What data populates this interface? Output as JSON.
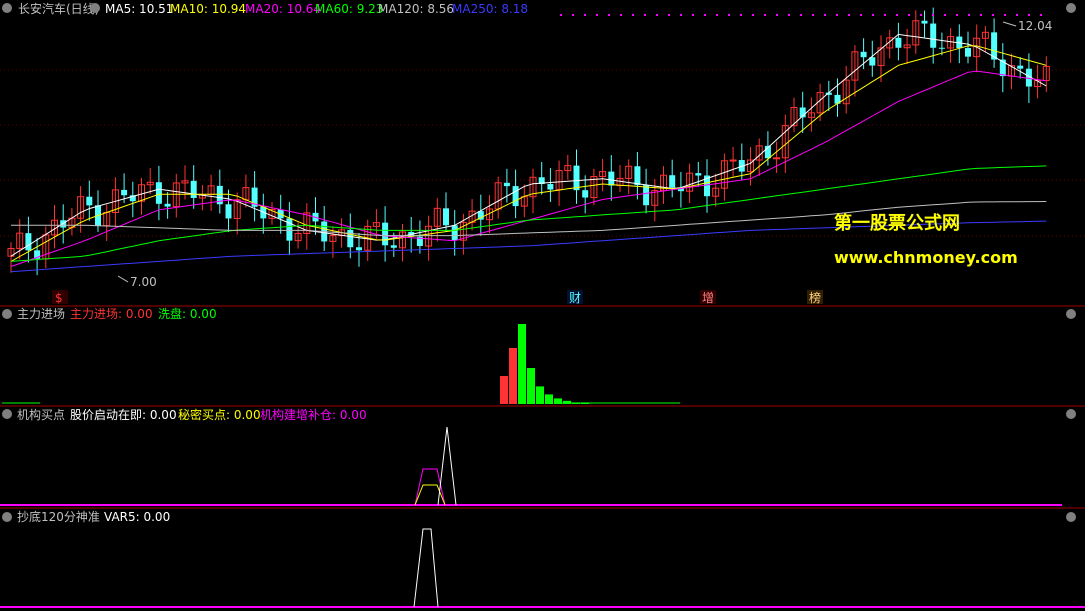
{
  "colors": {
    "bg": "#000000",
    "up": "#ff3333",
    "down": "#54ffff",
    "ma5": "#ffffff",
    "ma10": "#ffff00",
    "ma20": "#ff00ff",
    "ma60": "#00ff00",
    "ma120": "#c0c0c0",
    "ma250": "#3a3aff",
    "divider": "#a00000",
    "watermark": "#ffff00"
  },
  "main": {
    "stock_title": "长安汽车(日线)",
    "ma_items": [
      {
        "label": "MA5: 10.51",
        "color": "#ffffff"
      },
      {
        "label": "MA10: 10.94",
        "color": "#ffff00"
      },
      {
        "label": "MA20: 10.64",
        "color": "#ff00ff"
      },
      {
        "label": "MA60: 9.23",
        "color": "#00ff00"
      },
      {
        "label": "MA120: 8.56",
        "color": "#c0c0c0"
      },
      {
        "label": "MA250: 8.18",
        "color": "#3a3aff"
      }
    ],
    "high_label": "12.04",
    "low_label": "7.00",
    "markers": [
      "$",
      "财",
      "增",
      "榜"
    ],
    "watermark_title": "第一股票公式网",
    "watermark_url": "www.chnmoney.com"
  },
  "panel1": {
    "title": "主力进场",
    "items": [
      {
        "label": "主力进场: 0.00",
        "color": "#ff3333"
      },
      {
        "label": "洗盘: 0.00",
        "color": "#00ff00"
      }
    ]
  },
  "panel2": {
    "title": "机构买点",
    "items": [
      {
        "label": "股价启动在即: 0.00",
        "color": "#ffffff"
      },
      {
        "label": "秘密买点: 0.00",
        "color": "#ffff00"
      },
      {
        "label": "机构建增补仓: 0.00",
        "color": "#ff00ff"
      }
    ]
  },
  "panel3": {
    "title": "抄底120分神准",
    "items": [
      {
        "label": "VAR5: 0.00",
        "color": "#ffffff"
      }
    ]
  },
  "chart_data": {
    "type": "candlestick",
    "ma_trend": {
      "ma5": [
        7.5,
        8.4,
        8.8,
        8.6,
        8.0,
        7.8,
        8.1,
        8.9,
        9.0,
        8.8,
        9.3,
        10.6,
        11.8,
        11.6,
        10.8
      ],
      "ma10": [
        7.4,
        8.2,
        8.7,
        8.7,
        8.1,
        7.8,
        8.0,
        8.7,
        8.9,
        8.8,
        9.1,
        10.3,
        11.2,
        11.6,
        11.2
      ],
      "ma20": [
        7.3,
        7.8,
        8.4,
        8.6,
        8.3,
        7.9,
        7.8,
        8.2,
        8.6,
        8.8,
        9.0,
        9.7,
        10.5,
        11.1,
        10.9
      ],
      "ma60": [
        7.4,
        7.5,
        7.8,
        8.0,
        8.1,
        8.0,
        8.0,
        8.2,
        8.3,
        8.4,
        8.6,
        8.8,
        9.0,
        9.2,
        9.25
      ],
      "ma120": [
        8.1,
        8.1,
        8.05,
        8.0,
        8.0,
        7.9,
        7.9,
        7.95,
        8.0,
        8.1,
        8.2,
        8.3,
        8.45,
        8.55,
        8.56
      ],
      "ma250": [
        7.2,
        7.3,
        7.4,
        7.5,
        7.55,
        7.6,
        7.65,
        7.7,
        7.8,
        7.9,
        8.0,
        8.05,
        8.1,
        8.15,
        8.18
      ]
    },
    "price_range": [
      7.0,
      12.04
    ],
    "indicator_zhuli_bars": [
      0.35,
      0.7,
      1.0,
      0.45,
      0.22,
      0.12,
      0.07,
      0.04,
      0.02,
      0.02
    ],
    "indicator_jigou_peak": 1.0,
    "indicator_var5_peak": 1.0
  }
}
